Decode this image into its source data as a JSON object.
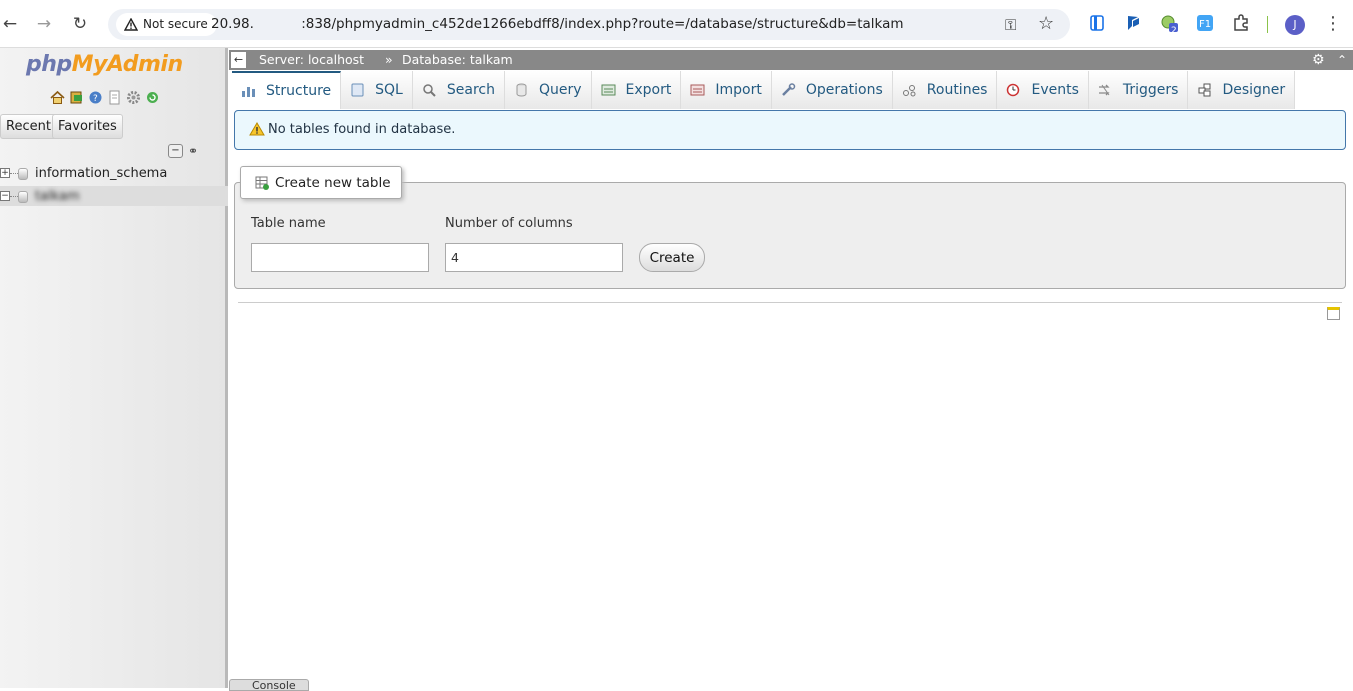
{
  "browser": {
    "security_label": "Not secure",
    "url": "20.98.       :838/phpmyadmin_c452de1266ebdff8/index.php?route=/database/structure&db=talkam",
    "avatar_initial": "J",
    "ext_badge": "2"
  },
  "nav": {
    "logo_php": "php",
    "logo_rest": "MyAdmin",
    "recent_label": "Recent",
    "favorites_label": "Favorites",
    "collapse_label": "−",
    "databases": [
      {
        "name": "information_schema",
        "expander": "+"
      },
      {
        "name": "talkam",
        "expander": "−"
      }
    ]
  },
  "topbar": {
    "server": "Server: localhost",
    "separator": "»",
    "database": "Database: talkam"
  },
  "tabs": [
    {
      "label": "Structure",
      "active": true
    },
    {
      "label": "SQL"
    },
    {
      "label": "Search"
    },
    {
      "label": "Query"
    },
    {
      "label": "Export"
    },
    {
      "label": "Import"
    },
    {
      "label": "Operations"
    },
    {
      "label": "Routines"
    },
    {
      "label": "Events"
    },
    {
      "label": "Triggers"
    },
    {
      "label": "Designer"
    }
  ],
  "notice": {
    "text": "No tables found in database."
  },
  "create_table": {
    "legend": "Create new table",
    "table_name_label": "Table name",
    "table_name_value": "",
    "num_columns_label": "Number of columns",
    "num_columns_value": "4",
    "create_label": "Create"
  },
  "console": {
    "label": "Console"
  },
  "colors": {
    "tab_text": "#235a81",
    "logo_php": "#6c78af",
    "logo_rest": "#f29c1f",
    "notice_bg": "#ebf8fd"
  }
}
